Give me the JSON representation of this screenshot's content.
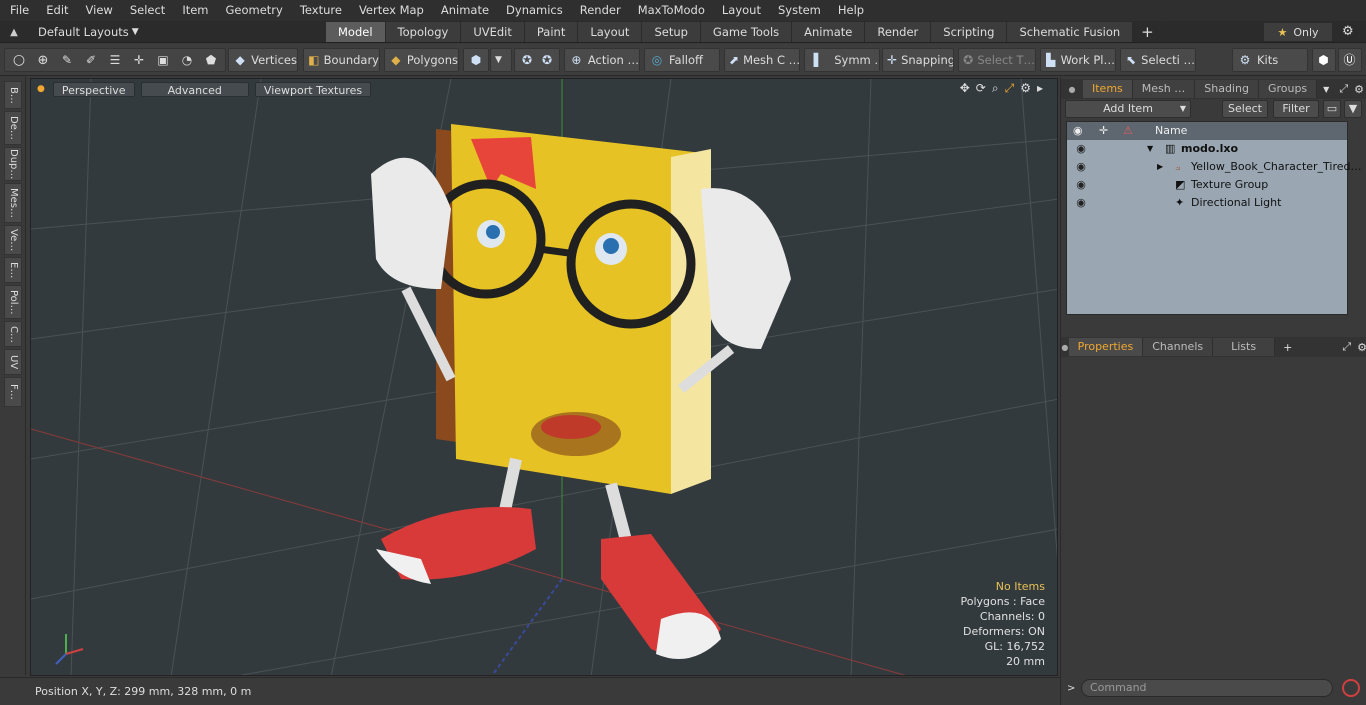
{
  "menu": [
    "File",
    "Edit",
    "View",
    "Select",
    "Item",
    "Geometry",
    "Texture",
    "Vertex Map",
    "Animate",
    "Dynamics",
    "Render",
    "MaxToModo",
    "Layout",
    "System",
    "Help"
  ],
  "layouts_dropdown": "Default Layouts",
  "tabs": [
    {
      "label": "Model",
      "active": true
    },
    {
      "label": "Topology"
    },
    {
      "label": "UVEdit"
    },
    {
      "label": "Paint"
    },
    {
      "label": "Layout"
    },
    {
      "label": "Setup"
    },
    {
      "label": "Game Tools"
    },
    {
      "label": "Animate"
    },
    {
      "label": "Render"
    },
    {
      "label": "Scripting"
    },
    {
      "label": "Schematic Fusion"
    }
  ],
  "only_label": "Only",
  "toolbar": {
    "vertices": "Vertices",
    "boundary": "Boundary",
    "polygons": "Polygons",
    "action": "Action …",
    "falloff": "Falloff",
    "mesh": "Mesh C …",
    "symm": "Symm …",
    "snapping": "Snapping",
    "select_t": "Select T…",
    "workpl": "Work Pl…",
    "selecti": "Selecti …",
    "kits": "Kits"
  },
  "left_tabs": [
    "B…",
    "De…",
    "Dup…",
    "Mes…",
    "Ve…",
    "E…",
    "Pol…",
    "C…",
    "UV",
    "F…"
  ],
  "viewport": {
    "perspective": "Perspective",
    "advanced": "Advanced",
    "textures": "Viewport Textures",
    "info": {
      "no_items": "No Items",
      "polygons": "Polygons : Face",
      "channels": "Channels: 0",
      "deformers": "Deformers: ON",
      "gl": "GL: 16,752",
      "scale": "20 mm"
    }
  },
  "status": "Position X, Y, Z:  299 mm, 328 mm, 0 m",
  "items_panel": {
    "tabs": [
      {
        "label": "Items",
        "active": true
      },
      {
        "label": "Mesh …"
      },
      {
        "label": "Shading"
      },
      {
        "label": "Groups"
      }
    ],
    "add_item": "Add Item",
    "select": "Select",
    "filter": "Filter",
    "name_header": "Name",
    "rows": [
      "modo.lxo",
      "Yellow_Book_Character_Tired…",
      "Texture Group",
      "Directional Light"
    ]
  },
  "props_panel": {
    "tabs": [
      {
        "label": "Properties",
        "active": true
      },
      {
        "label": "Channels"
      },
      {
        "label": "Lists"
      }
    ]
  },
  "command_placeholder": "Command",
  "colors": {
    "accent": "#f0a830",
    "viewport_bg": "#333a3e",
    "list_bg": "#9aa7b2"
  }
}
